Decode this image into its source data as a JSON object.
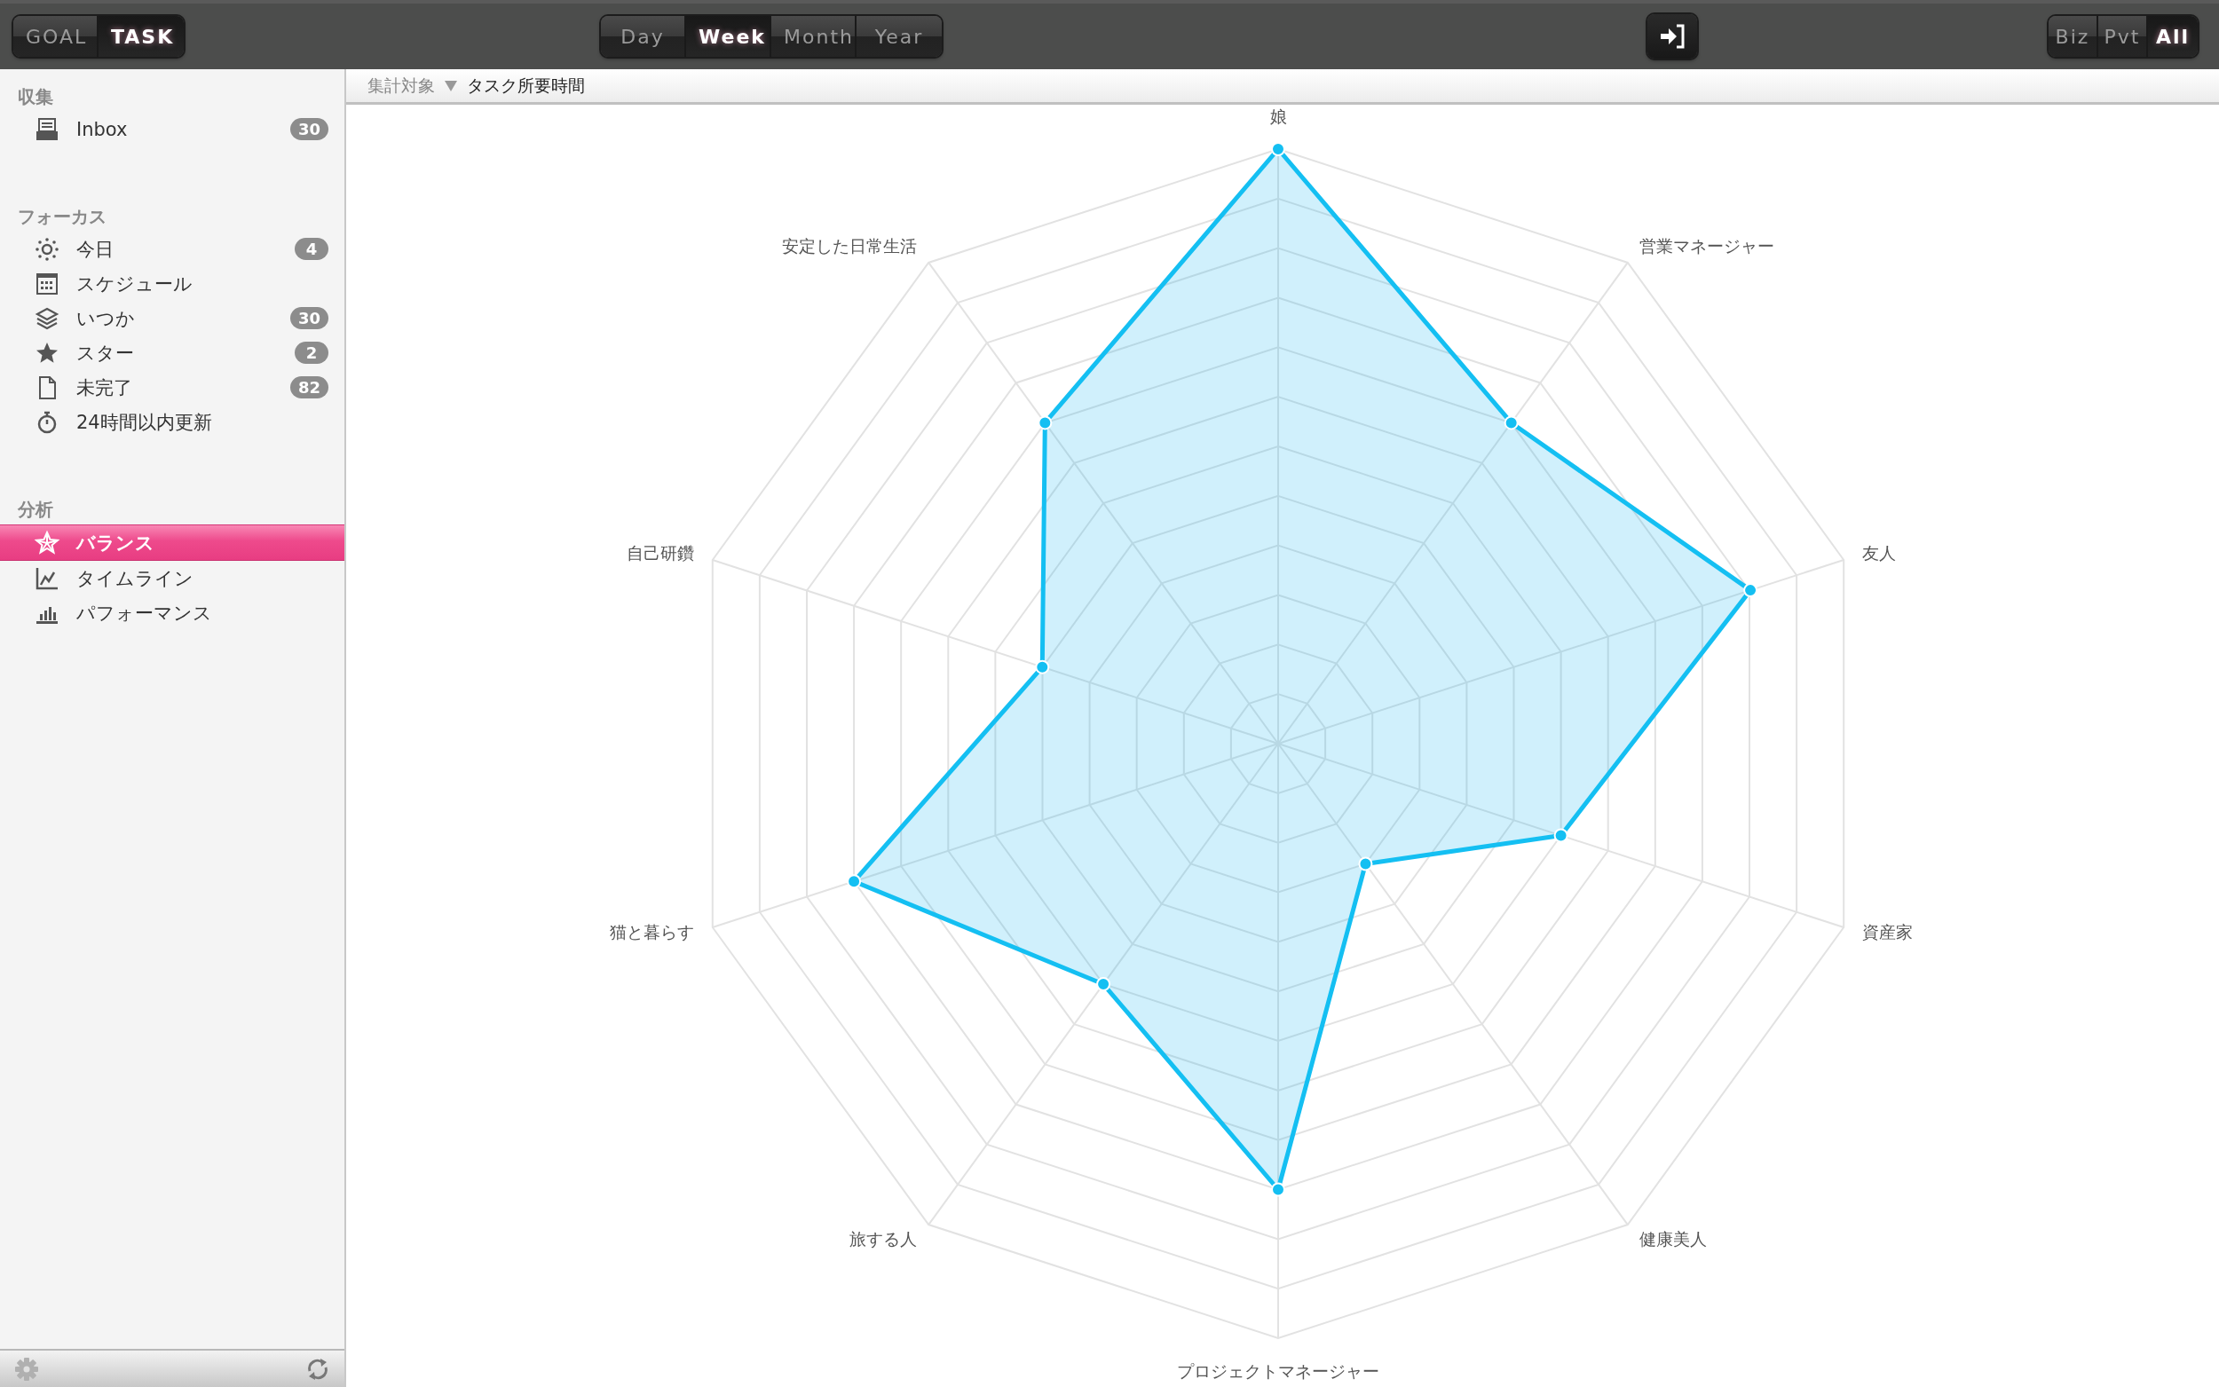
{
  "top_bar": {
    "mode_tabs": [
      {
        "label": "GOAL",
        "selected": false
      },
      {
        "label": "TASK",
        "selected": true
      }
    ],
    "period_tabs": [
      {
        "label": "Day",
        "selected": false
      },
      {
        "label": "Week",
        "selected": true
      },
      {
        "label": "Month",
        "selected": false
      },
      {
        "label": "Year",
        "selected": false
      }
    ],
    "scope_tabs": [
      {
        "label": "Biz",
        "selected": false
      },
      {
        "label": "Pvt",
        "selected": false
      },
      {
        "label": "All",
        "selected": true
      }
    ]
  },
  "sidebar": {
    "sections": [
      {
        "title": "収集",
        "items": [
          {
            "label": "Inbox",
            "count": "30",
            "selected": false
          }
        ]
      },
      {
        "title": "フォーカス",
        "items": [
          {
            "label": "今日",
            "count": "4",
            "selected": false
          },
          {
            "label": "スケジュール",
            "selected": false
          },
          {
            "label": "いつか",
            "count": "30",
            "selected": false
          },
          {
            "label": "スター",
            "count": "2",
            "selected": false
          },
          {
            "label": "未完了",
            "count": "82",
            "selected": false
          },
          {
            "label": "24時間以内更新",
            "selected": false
          }
        ]
      },
      {
        "title": "分析",
        "items": [
          {
            "label": "バランス",
            "selected": true
          },
          {
            "label": "タイムライン",
            "selected": false
          },
          {
            "label": "パフォーマンス",
            "selected": false
          }
        ]
      }
    ]
  },
  "chart_header": {
    "label": "集計対象",
    "value": "タスク所要時間"
  },
  "radar": {
    "axes": [
      "娘",
      "営業マネージャー",
      "友人",
      "資産家",
      "健康美人",
      "プロジェクトマネージャー",
      "旅する人",
      "猫と暮らす",
      "自己研鑽",
      "安定した日常生活"
    ]
  }
}
